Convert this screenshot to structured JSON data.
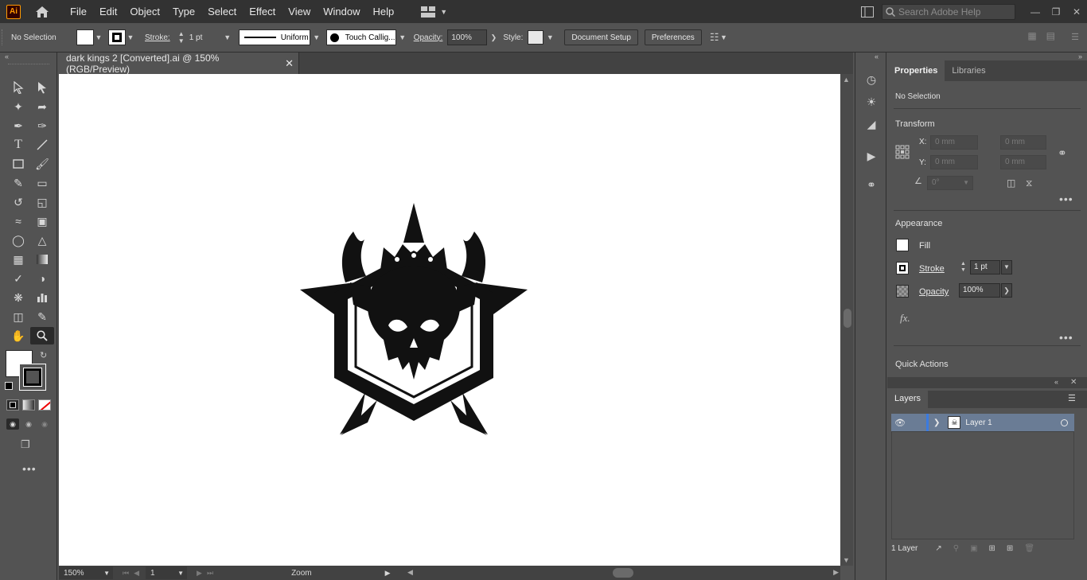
{
  "app": {
    "logo": "Ai"
  },
  "menu": [
    "File",
    "Edit",
    "Object",
    "Type",
    "Select",
    "Effect",
    "View",
    "Window",
    "Help"
  ],
  "search": {
    "placeholder": "Search Adobe Help"
  },
  "control": {
    "selection": "No Selection",
    "stroke_label": "Stroke:",
    "stroke_weight": "1 pt",
    "profile": "Uniform",
    "brush": "Touch Callig...",
    "opacity_label": "Opacity:",
    "opacity": "100%",
    "style_label": "Style:",
    "document_setup": "Document Setup",
    "preferences": "Preferences"
  },
  "document": {
    "tab_title": "dark kings 2 [Converted].ai @ 150% (RGB/Preview)",
    "zoom": "150%",
    "artboard": "1",
    "status_label": "Zoom"
  },
  "panel": {
    "tabs": [
      "Properties",
      "Libraries"
    ],
    "selection": "No Selection",
    "transform_title": "Transform",
    "x_label": "X:",
    "y_label": "Y:",
    "w_label": "W:",
    "h_label": "H:",
    "x_value": "0 mm",
    "y_value": "0 mm",
    "w_value": "0 mm",
    "h_value": "0 mm",
    "angle_value": "0°",
    "appearance_title": "Appearance",
    "fill_label": "Fill",
    "stroke_label": "Stroke",
    "stroke_weight": "1 pt",
    "opacity_label": "Opacity",
    "opacity_value": "100%",
    "fx_label": "fx.",
    "quick_actions_title": "Quick Actions"
  },
  "layers": {
    "title": "Layers",
    "layer_name": "Layer 1",
    "count": "1 Layer"
  },
  "colors": {
    "accent": "#6a7c95",
    "canvas": "#ffffff",
    "app_bg": "#535353"
  }
}
